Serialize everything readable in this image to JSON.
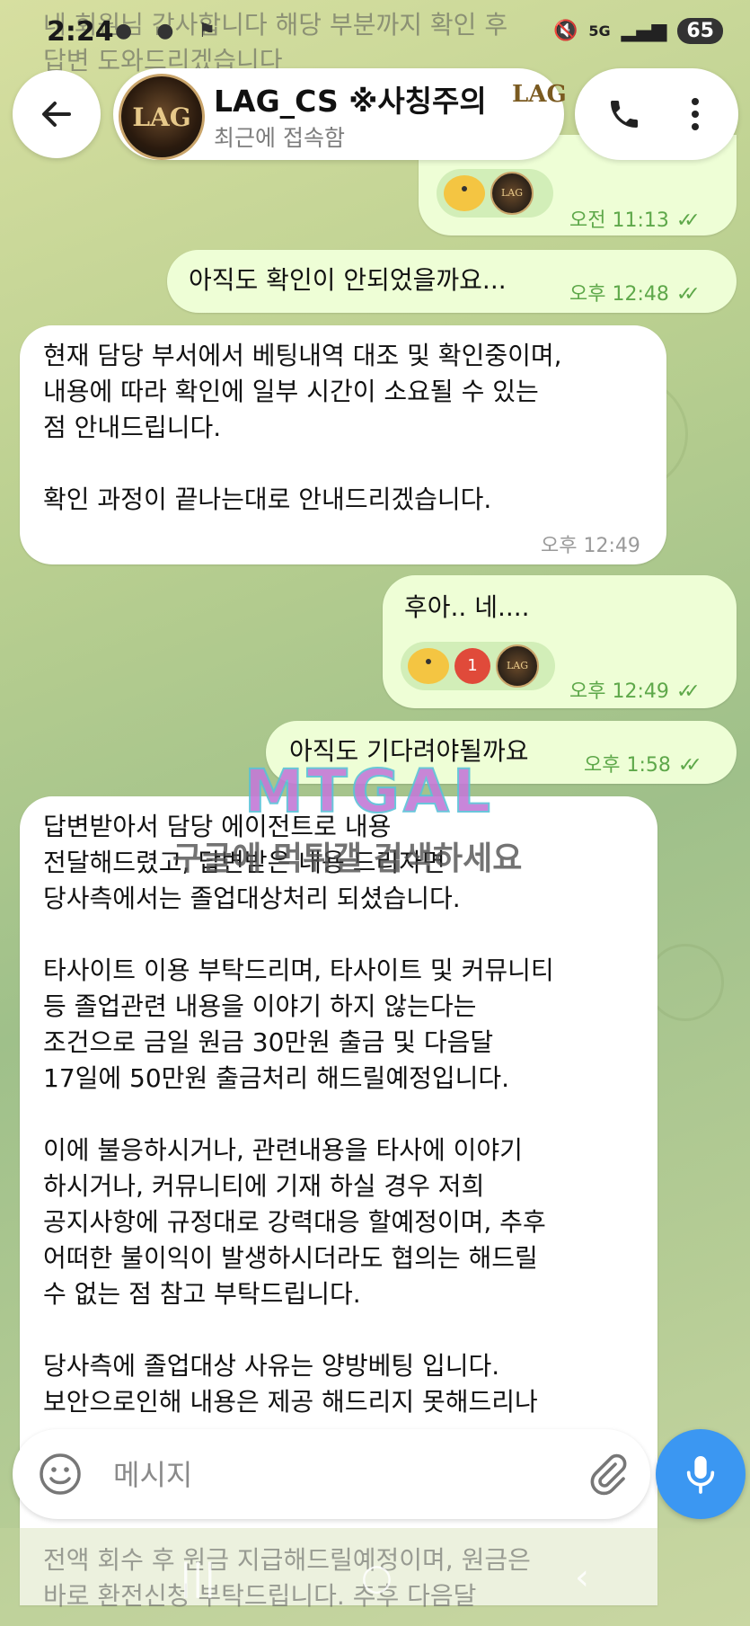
{
  "status_bar": {
    "time": "2:24",
    "notification_icons": "● ● ⚑",
    "network": "5G",
    "battery": "65"
  },
  "header": {
    "title": "LAG_CS ※사칭주의",
    "title_logo": "LAG",
    "subtitle": "최근에 접속함",
    "avatar_text": "LAG"
  },
  "peek_text": "네 회원님 감사합니다 해당 부분까지 확인 후\n답변 도와드리겠습니다",
  "messages": [
    {
      "dir": "out",
      "time": "오전 11:13",
      "reactions": true
    },
    {
      "dir": "out",
      "text": "아직도 확인이 안되었을까요...",
      "time": "오후 12:48"
    },
    {
      "dir": "in",
      "text": "현재 담당 부서에서 베팅내역 대조 및 확인중이며,\n내용에 따라 확인에 일부 시간이 소요될 수 있는\n점 안내드립니다.\n\n확인 과정이 끝나는대로 안내드리겠습니다.",
      "time": "오후 12:49"
    },
    {
      "dir": "out",
      "text": "후아..  네....",
      "time": "오후 12:49",
      "reaction_count": "1"
    },
    {
      "dir": "out",
      "text": "아직도 기다려야될까요",
      "time": "오후 1:58"
    },
    {
      "dir": "in",
      "text": "답변받아서 담당 에이전트로 내용\n전달해드렸고, 답변받은 내용 드리자면\n당사측에서는 졸업대상처리 되셨습니다.\n\n타사이트 이용 부탁드리며, 타사이트 및 커뮤니티\n등 졸업관련 내용을 이야기 하지 않는다는\n조건으로 금일 원금 30만원 출금 및 다음달\n17일에 50만원 출금처리 해드릴예정입니다.\n\n이에 불응하시거나, 관련내용을 타사에 이야기\n하시거나, 커뮤니티에 기재 하실 경우 저희\n공지사항에 규정대로 강력대응 할예정이며, 추후\n어떠한 불이익이 발생하시더라도 협의는 해드릴\n수 없는 점 참고 부탁드립니다.\n\n당사측에 졸업대상 사유는 양방베팅 입니다.\n보안으로인해 내용은 제공 해드리지 못해드리나"
    }
  ],
  "watermark": {
    "logo": "MTGAL",
    "text": "구글에 먹튀갤 검색하세요"
  },
  "input": {
    "placeholder": "메시지"
  },
  "bottom_peek": "전액 회수 후 원금 지급해드릴예정이며, 원금은\n바로 환전신청 부탁드립니다. 추후 다음달",
  "colors": {
    "outgoing_bubble": "#eefed6",
    "incoming_bubble": "#ffffff",
    "accent": "#3b97f2",
    "tick": "#5ea84a"
  },
  "icons": [
    "back-arrow-icon",
    "phone-icon",
    "more-vert-icon",
    "emoji-icon",
    "paperclip-icon",
    "mic-icon",
    "double-check-icon"
  ]
}
